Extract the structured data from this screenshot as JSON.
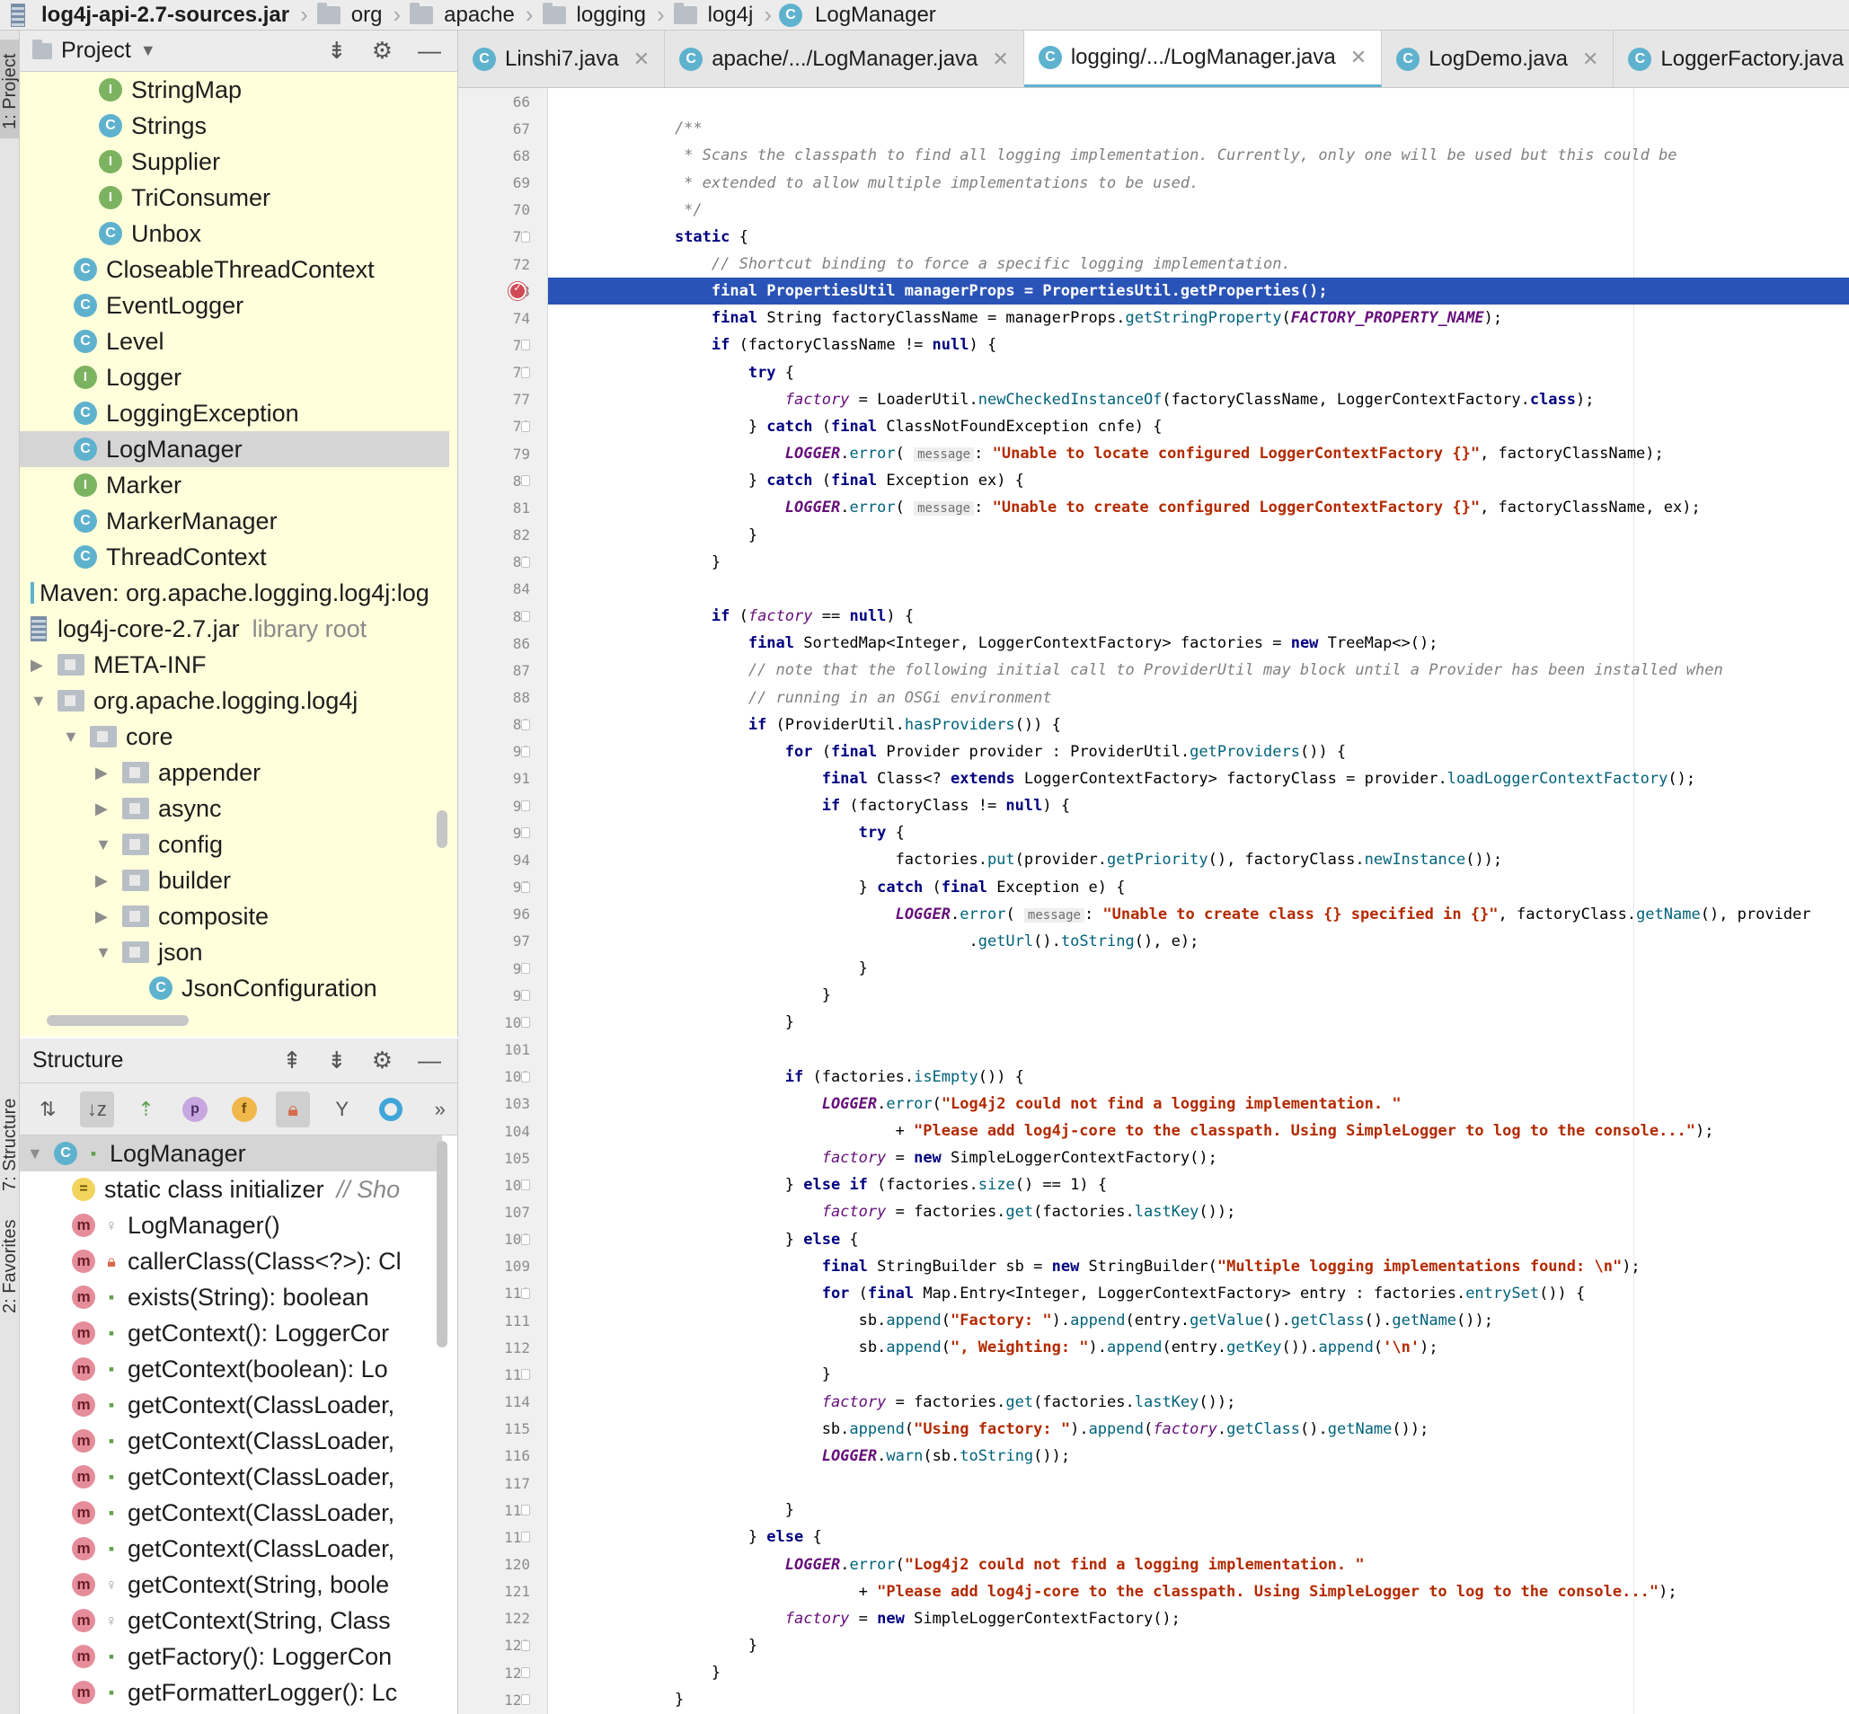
{
  "breadcrumb": [
    {
      "label": "log4j-api-2.7-sources.jar",
      "icon": "jar-icon",
      "bold": true
    },
    {
      "label": "org",
      "icon": "folder-icon"
    },
    {
      "label": "apache",
      "icon": "folder-icon"
    },
    {
      "label": "logging",
      "icon": "folder-icon"
    },
    {
      "label": "log4j",
      "icon": "folder-icon"
    },
    {
      "label": "LogManager",
      "icon": "class-icon"
    }
  ],
  "toolstrip": {
    "project_tab": "1: Project",
    "structure_tab": "7: Structure",
    "favorites_tab": "2: Favorites"
  },
  "project_panel": {
    "title": "Project",
    "tree": [
      {
        "label": "StringMap",
        "kind": "interface",
        "depth": 3
      },
      {
        "label": "Strings",
        "kind": "class",
        "depth": 3
      },
      {
        "label": "Supplier",
        "kind": "interface",
        "depth": 3
      },
      {
        "label": "TriConsumer",
        "kind": "interface",
        "depth": 3
      },
      {
        "label": "Unbox",
        "kind": "class",
        "depth": 3
      },
      {
        "label": "CloseableThreadContext",
        "kind": "class",
        "depth": 2
      },
      {
        "label": "EventLogger",
        "kind": "class",
        "depth": 2
      },
      {
        "label": "Level",
        "kind": "class",
        "depth": 2
      },
      {
        "label": "Logger",
        "kind": "interface",
        "depth": 2
      },
      {
        "label": "LoggingException",
        "kind": "class",
        "depth": 2
      },
      {
        "label": "LogManager",
        "kind": "class",
        "depth": 2,
        "selected": true
      },
      {
        "label": "Marker",
        "kind": "interface",
        "depth": 2
      },
      {
        "label": "MarkerManager",
        "kind": "class",
        "depth": 2
      },
      {
        "label": "ThreadContext",
        "kind": "class",
        "depth": 2
      },
      {
        "label": "Maven: org.apache.logging.log4j:log",
        "kind": "maven",
        "depth": 0
      },
      {
        "label": "log4j-core-2.7.jar",
        "suffix": "library root",
        "kind": "jar",
        "depth": 0
      },
      {
        "label": "META-INF",
        "kind": "package",
        "depth": 0,
        "arrow": "collapsed"
      },
      {
        "label": "org.apache.logging.log4j",
        "kind": "package",
        "depth": 0,
        "arrow": "expanded"
      },
      {
        "label": "core",
        "kind": "package",
        "depth": 1,
        "arrow": "expanded"
      },
      {
        "label": "appender",
        "kind": "package",
        "depth": 2,
        "arrow": "collapsed"
      },
      {
        "label": "async",
        "kind": "package",
        "depth": 2,
        "arrow": "collapsed"
      },
      {
        "label": "config",
        "kind": "package",
        "depth": 2,
        "arrow": "expanded"
      },
      {
        "label": "builder",
        "kind": "package",
        "depth": 3,
        "arrow": "collapsed"
      },
      {
        "label": "composite",
        "kind": "package",
        "depth": 3,
        "arrow": "collapsed"
      },
      {
        "label": "json",
        "kind": "package",
        "depth": 3,
        "arrow": "expanded"
      },
      {
        "label": "JsonConfiguration",
        "kind": "class",
        "depth": 4
      }
    ]
  },
  "structure_panel": {
    "title": "Structure",
    "items": [
      {
        "label": "LogManager",
        "kind": "class",
        "vis": "pub",
        "root": true,
        "selected": true
      },
      {
        "label": "static class initializer",
        "comment": "// Sho",
        "kind": "init"
      },
      {
        "label": "LogManager()",
        "kind": "method",
        "vis": "pkg"
      },
      {
        "label": "callerClass(Class<?>): Cl",
        "kind": "method",
        "vis": "priv"
      },
      {
        "label": "exists(String): boolean",
        "kind": "method",
        "vis": "pub"
      },
      {
        "label": "getContext(): LoggerCor",
        "kind": "method",
        "vis": "pub"
      },
      {
        "label": "getContext(boolean): Lo",
        "kind": "method",
        "vis": "pub"
      },
      {
        "label": "getContext(ClassLoader,",
        "kind": "method",
        "vis": "pub"
      },
      {
        "label": "getContext(ClassLoader,",
        "kind": "method",
        "vis": "pub"
      },
      {
        "label": "getContext(ClassLoader,",
        "kind": "method",
        "vis": "pub"
      },
      {
        "label": "getContext(ClassLoader,",
        "kind": "method",
        "vis": "pub"
      },
      {
        "label": "getContext(ClassLoader,",
        "kind": "method",
        "vis": "pub"
      },
      {
        "label": "getContext(String, boole",
        "kind": "method",
        "vis": "pkg"
      },
      {
        "label": "getContext(String, Class",
        "kind": "method",
        "vis": "pkg"
      },
      {
        "label": "getFactory(): LoggerCon",
        "kind": "method",
        "vis": "pub"
      },
      {
        "label": "getFormatterLogger(): Lc",
        "kind": "method",
        "vis": "pub"
      }
    ]
  },
  "tabs": [
    {
      "label": "Linshi7.java",
      "active": false
    },
    {
      "label": "apache/.../LogManager.java",
      "active": false
    },
    {
      "label": "logging/.../LogManager.java",
      "active": true
    },
    {
      "label": "LogDemo.java",
      "active": false
    },
    {
      "label": "LoggerFactory.java",
      "active": false
    }
  ],
  "editor": {
    "breakpoint_line": 73,
    "lines": [
      {
        "n": 66,
        "t": ""
      },
      {
        "n": 67,
        "t": "    /**"
      },
      {
        "n": 68,
        "t": "     * Scans the classpath to find all logging implementation. Currently, only one will be used but this could be"
      },
      {
        "n": 69,
        "t": "     * extended to allow multiple implementations to be used."
      },
      {
        "n": 70,
        "t": "     */"
      },
      {
        "n": 71,
        "t": "    static {"
      },
      {
        "n": 72,
        "t": "        // Shortcut binding to force a specific logging implementation."
      },
      {
        "n": 73,
        "t": "        final PropertiesUtil managerProps = PropertiesUtil.getProperties();"
      },
      {
        "n": 74,
        "t": "        final String factoryClassName = managerProps.getStringProperty(FACTORY_PROPERTY_NAME);"
      },
      {
        "n": 75,
        "t": "        if (factoryClassName != null) {"
      },
      {
        "n": 76,
        "t": "            try {"
      },
      {
        "n": 77,
        "t": "                factory = LoaderUtil.newCheckedInstanceOf(factoryClassName, LoggerContextFactory.class);"
      },
      {
        "n": 78,
        "t": "            } catch (final ClassNotFoundException cnfe) {"
      },
      {
        "n": 79,
        "t": "                LOGGER.error( message: \"Unable to locate configured LoggerContextFactory {}\", factoryClassName);"
      },
      {
        "n": 80,
        "t": "            } catch (final Exception ex) {"
      },
      {
        "n": 81,
        "t": "                LOGGER.error( message: \"Unable to create configured LoggerContextFactory {}\", factoryClassName, ex);"
      },
      {
        "n": 82,
        "t": "            }"
      },
      {
        "n": 83,
        "t": "        }"
      },
      {
        "n": 84,
        "t": ""
      },
      {
        "n": 85,
        "t": "        if (factory == null) {"
      },
      {
        "n": 86,
        "t": "            final SortedMap<Integer, LoggerContextFactory> factories = new TreeMap<>();"
      },
      {
        "n": 87,
        "t": "            // note that the following initial call to ProviderUtil may block until a Provider has been installed when"
      },
      {
        "n": 88,
        "t": "            // running in an OSGi environment"
      },
      {
        "n": 89,
        "t": "            if (ProviderUtil.hasProviders()) {"
      },
      {
        "n": 90,
        "t": "                for (final Provider provider : ProviderUtil.getProviders()) {"
      },
      {
        "n": 91,
        "t": "                    final Class<? extends LoggerContextFactory> factoryClass = provider.loadLoggerContextFactory();"
      },
      {
        "n": 92,
        "t": "                    if (factoryClass != null) {"
      },
      {
        "n": 93,
        "t": "                        try {"
      },
      {
        "n": 94,
        "t": "                            factories.put(provider.getPriority(), factoryClass.newInstance());"
      },
      {
        "n": 95,
        "t": "                        } catch (final Exception e) {"
      },
      {
        "n": 96,
        "t": "                            LOGGER.error( message: \"Unable to create class {} specified in {}\", factoryClass.getName(), provider"
      },
      {
        "n": 97,
        "t": "                                    .getUrl().toString(), e);"
      },
      {
        "n": 98,
        "t": "                        }"
      },
      {
        "n": 99,
        "t": "                    }"
      },
      {
        "n": 100,
        "t": "                }"
      },
      {
        "n": 101,
        "t": ""
      },
      {
        "n": 102,
        "t": "                if (factories.isEmpty()) {"
      },
      {
        "n": 103,
        "t": "                    LOGGER.error(\"Log4j2 could not find a logging implementation. \""
      },
      {
        "n": 104,
        "t": "                            + \"Please add log4j-core to the classpath. Using SimpleLogger to log to the console...\");"
      },
      {
        "n": 105,
        "t": "                    factory = new SimpleLoggerContextFactory();"
      },
      {
        "n": 106,
        "t": "                } else if (factories.size() == 1) {"
      },
      {
        "n": 107,
        "t": "                    factory = factories.get(factories.lastKey());"
      },
      {
        "n": 108,
        "t": "                } else {"
      },
      {
        "n": 109,
        "t": "                    final StringBuilder sb = new StringBuilder(\"Multiple logging implementations found: \\n\");"
      },
      {
        "n": 110,
        "t": "                    for (final Map.Entry<Integer, LoggerContextFactory> entry : factories.entrySet()) {"
      },
      {
        "n": 111,
        "t": "                        sb.append(\"Factory: \").append(entry.getValue().getClass().getName());"
      },
      {
        "n": 112,
        "t": "                        sb.append(\", Weighting: \").append(entry.getKey()).append('\\n');"
      },
      {
        "n": 113,
        "t": "                    }"
      },
      {
        "n": 114,
        "t": "                    factory = factories.get(factories.lastKey());"
      },
      {
        "n": 115,
        "t": "                    sb.append(\"Using factory: \").append(factory.getClass().getName());"
      },
      {
        "n": 116,
        "t": "                    LOGGER.warn(sb.toString());"
      },
      {
        "n": 117,
        "t": ""
      },
      {
        "n": 118,
        "t": "                }"
      },
      {
        "n": 119,
        "t": "            } else {"
      },
      {
        "n": 120,
        "t": "                LOGGER.error(\"Log4j2 could not find a logging implementation. \""
      },
      {
        "n": 121,
        "t": "                        + \"Please add log4j-core to the classpath. Using SimpleLogger to log to the console...\");"
      },
      {
        "n": 122,
        "t": "                factory = new SimpleLoggerContextFactory();"
      },
      {
        "n": 123,
        "t": "            }"
      },
      {
        "n": 124,
        "t": "        }"
      },
      {
        "n": 125,
        "t": "    }"
      }
    ]
  },
  "colors": {
    "keyword": "#000080",
    "comment": "#808080",
    "string": "#b32a00",
    "field": "#660e7a",
    "method": "#00627a",
    "current_line": "#2a53b7",
    "project_bg": "#ffffdc"
  }
}
